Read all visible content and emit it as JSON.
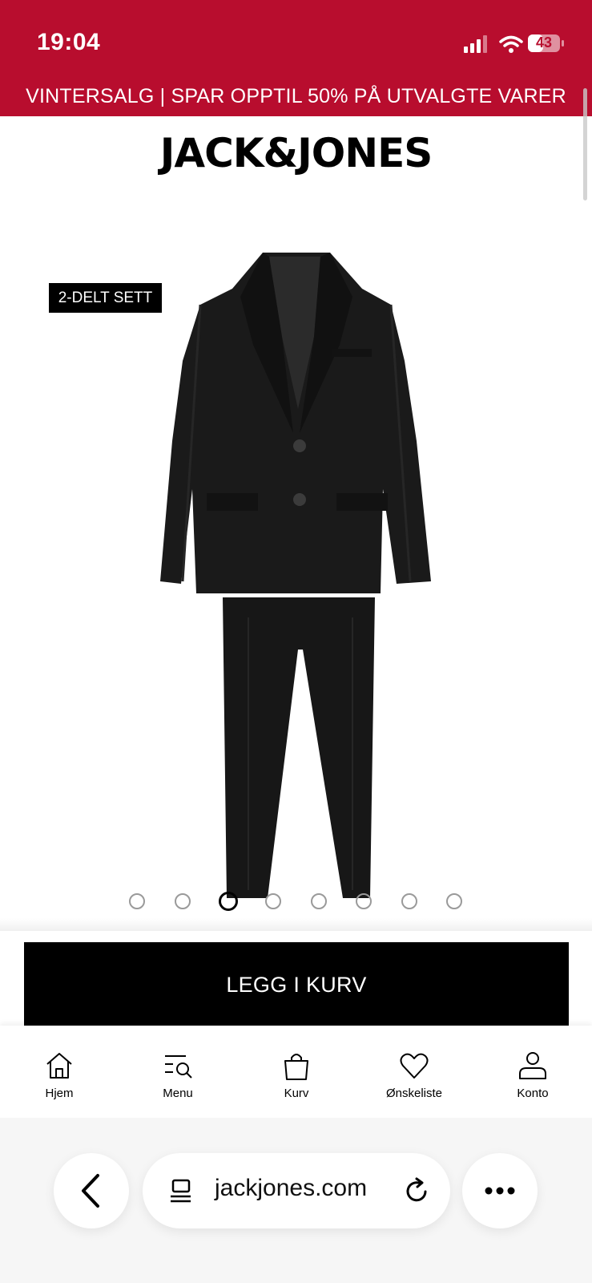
{
  "status_bar": {
    "time": "19:04",
    "battery": "43"
  },
  "promo": {
    "text": "VINTERSALG | SPAR OPPTIL 50% PÅ UTVALGTE VARER"
  },
  "brand": {
    "logo": "JACK&JONES"
  },
  "gallery": {
    "badge": "2-DELT SETT",
    "image": "black-suit-image",
    "dot_count": 8,
    "active_dot": 3
  },
  "cta": {
    "add_to_cart": "LEGG I KURV"
  },
  "bottom_nav": {
    "items": [
      {
        "label": "Hjem",
        "icon": "home-icon"
      },
      {
        "label": "Menu",
        "icon": "menu-search-icon"
      },
      {
        "label": "Kurv",
        "icon": "bag-icon"
      },
      {
        "label": "Ønskeliste",
        "icon": "heart-icon"
      },
      {
        "label": "Konto",
        "icon": "user-icon"
      }
    ]
  },
  "browser": {
    "url": "jackjones.com"
  },
  "colors": {
    "brand_red": "#b80d2e",
    "black": "#000000"
  }
}
